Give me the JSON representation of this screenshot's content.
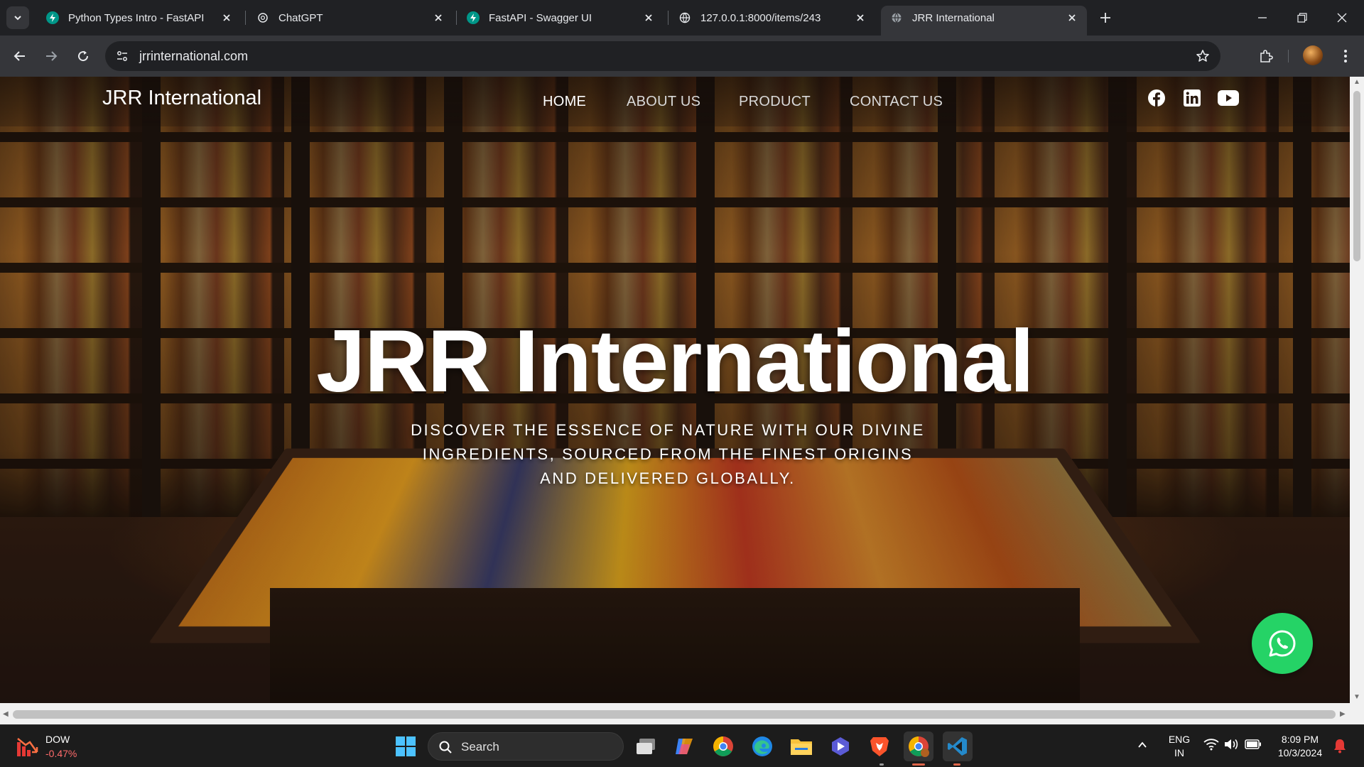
{
  "browser": {
    "tabs": [
      {
        "title": "Python Types Intro - FastAPI",
        "favicon": "fastapi-icon",
        "active": false
      },
      {
        "title": "ChatGPT",
        "favicon": "chatgpt-icon",
        "active": false
      },
      {
        "title": "FastAPI - Swagger UI",
        "favicon": "fastapi-icon",
        "active": false
      },
      {
        "title": "127.0.0.1:8000/items/243",
        "favicon": "globe-icon",
        "active": false
      },
      {
        "title": "JRR International",
        "favicon": "globe-icon",
        "active": true
      }
    ],
    "url": "jrrinternational.com"
  },
  "site": {
    "brand": "JRR International",
    "nav": [
      "HOME",
      "ABOUT US",
      "PRODUCT",
      "CONTACT US"
    ],
    "active_nav": "HOME",
    "social": [
      "facebook-icon",
      "linkedin-icon",
      "youtube-icon"
    ],
    "hero_title": "JRR International",
    "hero_subtitle_lines": [
      "DISCOVER THE ESSENCE OF NATURE WITH OUR DIVINE",
      "INGREDIENTS, SOURCED FROM THE FINEST ORIGINS",
      "AND DELIVERED GLOBALLY."
    ],
    "whatsapp": "whatsapp-icon"
  },
  "taskbar": {
    "stock": {
      "name": "DOW",
      "change": "-0.47%"
    },
    "search_label": "Search",
    "language": {
      "line1": "ENG",
      "line2": "IN"
    },
    "time": "8:09 PM",
    "date": "10/3/2024"
  },
  "colors": {
    "whatsapp_green": "#25d366",
    "tab_bg": "#202124",
    "toolbar_bg": "#35363a",
    "stock_negative": "#ff6b6b"
  }
}
